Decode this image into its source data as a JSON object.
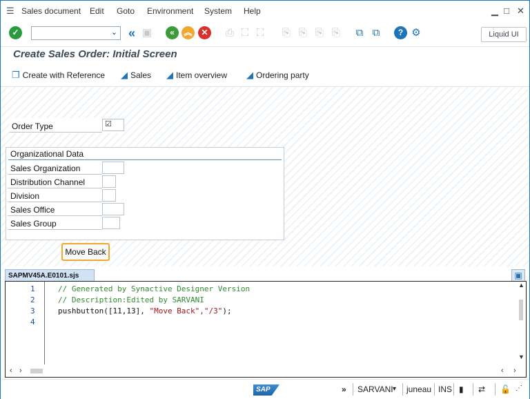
{
  "menu": {
    "items": [
      "Sales document",
      "Edit",
      "Goto",
      "Environment",
      "System",
      "Help"
    ]
  },
  "toolbar": {
    "liquid_ui": "Liquid UI",
    "command_field": ""
  },
  "screen": {
    "title": "Create Sales Order: Initial Screen"
  },
  "app_toolbar": {
    "create_ref": "Create with Reference",
    "sales": "Sales",
    "item_overview": "Item overview",
    "ordering_party": "Ordering party"
  },
  "form": {
    "order_type_label": "Order Type",
    "order_type_value": "☑",
    "org_group_title": "Organizational Data",
    "fields": [
      {
        "label": "Sales Organization",
        "value": ""
      },
      {
        "label": "Distribution Channel",
        "value": ""
      },
      {
        "label": "Division",
        "value": ""
      },
      {
        "label": "Sales Office",
        "value": ""
      },
      {
        "label": "Sales Group",
        "value": ""
      }
    ],
    "move_back": "Move Back"
  },
  "editor": {
    "file_tab": "SAPMV45A.E0101.sjs",
    "lines": [
      {
        "num": "1",
        "text": "// Generated by Synactive Designer Version"
      },
      {
        "num": "2",
        "text": "// Description:Edited by SARVANI"
      },
      {
        "num": "3",
        "pre": "pushbutton([11,13], ",
        "str": "\"Move Back\",\"/3\"",
        "post": ");"
      },
      {
        "num": "4",
        "text": ""
      }
    ]
  },
  "status": {
    "user": "SARVANI",
    "server": "juneau",
    "mode": "INS"
  },
  "colors": {
    "brand_blue": "#1f74ba",
    "enter_green": "#2a9a3e",
    "back_green": "#3c9c3c",
    "exit_orange": "#f0a92e",
    "cancel_red": "#d6312c",
    "help_blue": "#1f73b7",
    "move_back_border": "#f0a92e"
  }
}
